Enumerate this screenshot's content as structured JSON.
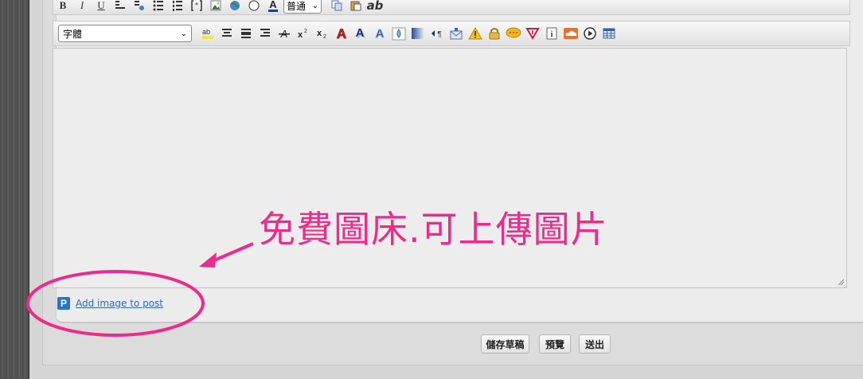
{
  "toolbar": {
    "row1": {
      "bold": "B",
      "italic": "I",
      "underline": "U",
      "size_select": "普通",
      "spellcheck_label": "ab"
    },
    "row2": {
      "font_select": "字體"
    }
  },
  "annotation": {
    "text": "免費圖床.可上傳圖片",
    "color": "#ee2a8a"
  },
  "attach": {
    "link_label": "Add image to post",
    "icon_letter": "P"
  },
  "buttons": {
    "save_draft": "儲存草稿",
    "preview": "預覽",
    "submit": "送出"
  },
  "icons": [
    "bold-icon",
    "italic-icon",
    "underline-icon",
    "align-left-icon",
    "indent-icon",
    "bulleted-list-icon",
    "numbered-list-icon",
    "code-icon",
    "image-icon",
    "globe-icon",
    "compass-icon",
    "font-color-icon",
    "copy-icon",
    "paste-icon",
    "spellcheck-icon",
    "highlight-icon",
    "align-center-icon",
    "align-justify-icon",
    "align-right-icon",
    "strikethrough-icon",
    "superscript-icon",
    "subscript-icon",
    "text-shadow-icon",
    "text-glow-icon",
    "text-outline-icon",
    "drop-icon",
    "gradient-icon",
    "paragraph-rtl-icon",
    "email-icon",
    "warning-icon",
    "lock-icon",
    "speech-bubble-icon",
    "down-arrow-icon",
    "info-icon",
    "soundcloud-icon",
    "play-icon",
    "table-icon"
  ]
}
